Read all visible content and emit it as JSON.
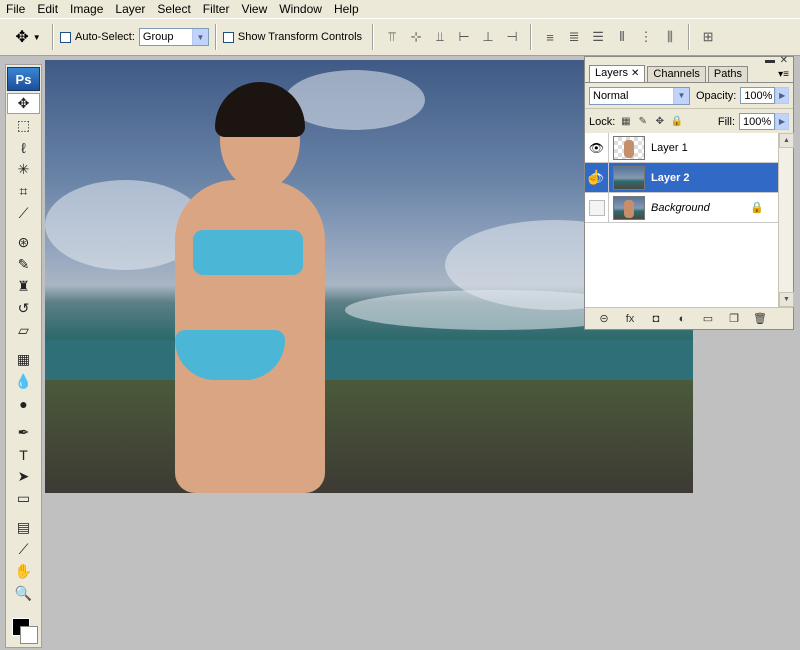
{
  "menu": [
    "File",
    "Edit",
    "Image",
    "Layer",
    "Select",
    "Filter",
    "View",
    "Window",
    "Help"
  ],
  "options": {
    "tool_icon": "move-tool-icon",
    "auto_select_label": "Auto-Select:",
    "auto_select_value": "Group",
    "show_transform_label": "Show Transform Controls",
    "align_icons": [
      "align-top-icon",
      "align-vcenter-icon",
      "align-bottom-icon",
      "align-left-icon",
      "align-hcenter-icon",
      "align-right-icon"
    ],
    "distribute_icons": [
      "distribute-top-icon",
      "distribute-vcenter-icon",
      "distribute-bottom-icon",
      "distribute-left-icon",
      "distribute-hcenter-icon",
      "distribute-right-icon"
    ],
    "auto_align_icon": "auto-align-icon"
  },
  "tools": {
    "logo": "Ps",
    "items": [
      {
        "name": "move-tool",
        "glyph": "✥",
        "active": true
      },
      {
        "name": "marquee-tool",
        "glyph": "⬚"
      },
      {
        "name": "lasso-tool",
        "glyph": "ℓ"
      },
      {
        "name": "magic-wand-tool",
        "glyph": "✳"
      },
      {
        "name": "crop-tool",
        "glyph": "⌗"
      },
      {
        "name": "eyedropper-tool",
        "glyph": "⟋"
      },
      {
        "name": "healing-tool",
        "glyph": "⊛"
      },
      {
        "name": "brush-tool",
        "glyph": "✎"
      },
      {
        "name": "stamp-tool",
        "glyph": "♜"
      },
      {
        "name": "history-brush-tool",
        "glyph": "↺"
      },
      {
        "name": "eraser-tool",
        "glyph": "▱"
      },
      {
        "name": "gradient-tool",
        "glyph": "▦"
      },
      {
        "name": "blur-tool",
        "glyph": "💧"
      },
      {
        "name": "dodge-tool",
        "glyph": "●"
      },
      {
        "name": "pen-tool",
        "glyph": "✒"
      },
      {
        "name": "type-tool",
        "glyph": "T"
      },
      {
        "name": "path-select-tool",
        "glyph": "➤"
      },
      {
        "name": "shape-tool",
        "glyph": "▭"
      },
      {
        "name": "notes-tool",
        "glyph": "▤"
      },
      {
        "name": "eyedropper2-tool",
        "glyph": "⟋"
      },
      {
        "name": "hand-tool",
        "glyph": "✋"
      },
      {
        "name": "zoom-tool",
        "glyph": "🔍"
      }
    ],
    "foreground_color": "#000000",
    "background_color": "#ffffff"
  },
  "layers_panel": {
    "tabs": [
      "Layers",
      "Channels",
      "Paths"
    ],
    "blend_mode": "Normal",
    "opacity_label": "Opacity:",
    "opacity_value": "100%",
    "lock_label": "Lock:",
    "fill_label": "Fill:",
    "fill_value": "100%",
    "layers": [
      {
        "name": "Layer 1",
        "visible": true,
        "selected": false
      },
      {
        "name": "Layer 2",
        "visible": true,
        "selected": true
      },
      {
        "name": "Background",
        "visible": false,
        "selected": false,
        "locked": true
      }
    ],
    "bottom_icons": [
      "link-layers-icon",
      "fx-icon",
      "add-mask-icon",
      "adjustment-layer-icon",
      "new-group-icon",
      "new-layer-icon",
      "delete-layer-icon"
    ],
    "bottom_glyphs": [
      "⊝",
      "fx",
      "◘",
      "◐",
      "▭",
      "❐",
      "🗑"
    ]
  }
}
